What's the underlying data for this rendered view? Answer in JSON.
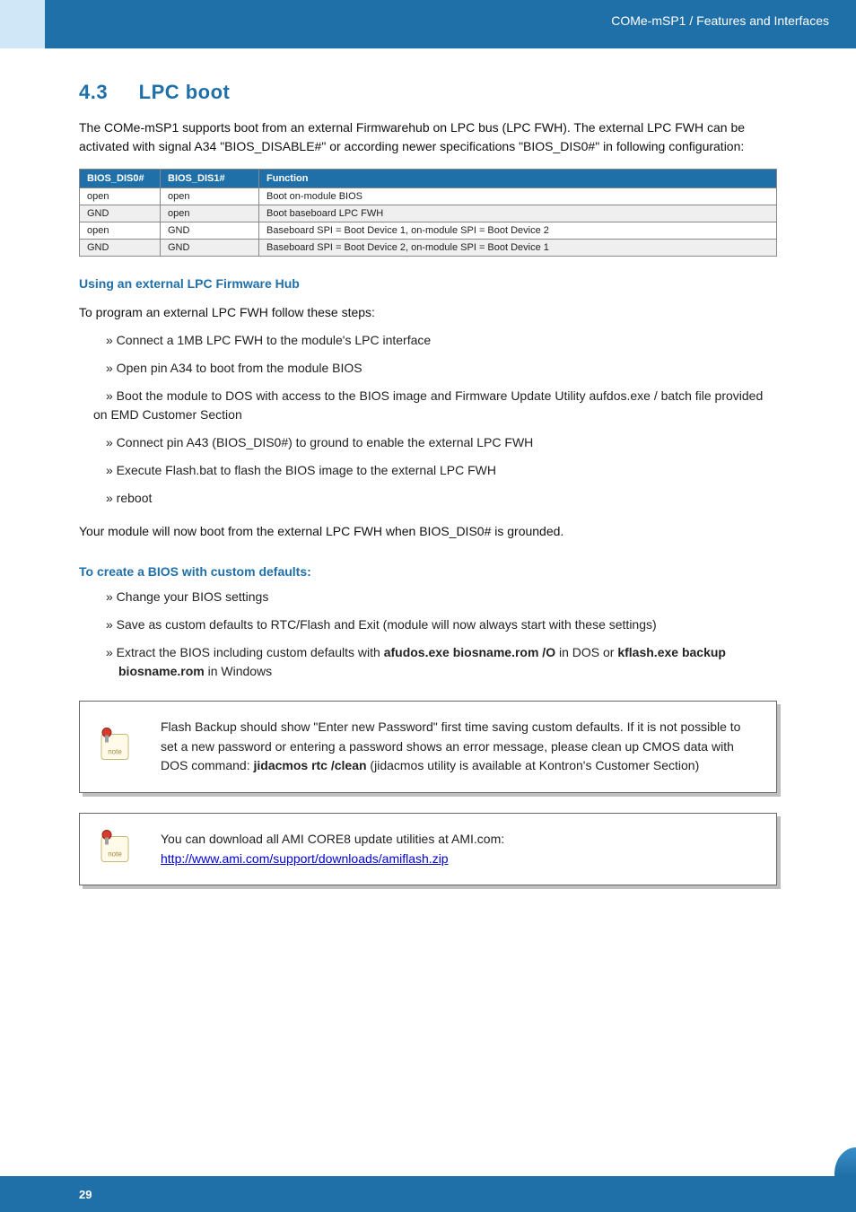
{
  "header": {
    "breadcrumb": "COMe-mSP1 / Features and Interfaces"
  },
  "section": {
    "number": "4.3",
    "title": "LPC boot"
  },
  "intro": "The COMe-mSP1 supports boot from an external Firmwarehub on LPC bus (LPC FWH). The external LPC FWH can be activated with signal A34 \"BIOS_DISABLE#\" or according newer specifications \"BIOS_DIS0#\" in following configuration:",
  "table": {
    "headers": [
      "BIOS_DIS0#",
      "BIOS_DIS1#",
      "Function"
    ],
    "rows": [
      [
        "open",
        "open",
        "Boot on-module BIOS"
      ],
      [
        "GND",
        "open",
        "Boot baseboard LPC FWH"
      ],
      [
        "open",
        "GND",
        "Baseboard SPI = Boot Device 1, on-module SPI = Boot Device 2"
      ],
      [
        "GND",
        "GND",
        "Baseboard SPI = Boot Device 2, on-module SPI = Boot Device 1"
      ]
    ]
  },
  "sec1": {
    "heading": "Using an external LPC Firmware Hub",
    "lead": "To program an external LPC FWH follow these steps:",
    "b1": "» Connect a 1MB LPC FWH to the module's LPC interface",
    "b2": "» Open pin A34 to boot from the module BIOS",
    "b3a": "» Boot the module to DOS with access to the BIOS image and Firmware Update Utility aufdos.exe / batch file provided",
    "b3b": "on EMD Customer Section",
    "b4": "» Connect pin A43 (BIOS_DIS0#) to ground to enable the external LPC FWH",
    "b5": "» Execute Flash.bat to flash the BIOS image to the external LPC FWH",
    "b6": "» reboot",
    "tail": "Your module will now boot from the external LPC FWH when BIOS_DIS0# is grounded."
  },
  "sec2": {
    "heading": "To create a BIOS with custom defaults:",
    "b1": "» Change your BIOS settings",
    "b2": "» Save as custom defaults to RTC/Flash and Exit (module will now always start with these settings)",
    "b3_prefix": "» Extract the BIOS including custom defaults with ",
    "b3_cmd1": "afudos.exe biosname.rom /O",
    "b3_mid": " in DOS or ",
    "b3_cmd2": "kflash.exe backup biosname.rom",
    "b3_suffix": " in Windows"
  },
  "note1": {
    "t1": "Flash Backup should show \"Enter new Password\" first time saving custom defaults. If it is not possible to set a new password or entering a password shows an error message, please clean up CMOS data with DOS command: ",
    "cmd": "jidacmos rtc /clean",
    "t2": " (jidacmos utility is available at Kontron's Customer Section)"
  },
  "note2": {
    "t1": "You can download all AMI CORE8 update utilities at AMI.com:",
    "link": "http://www.ami.com/support/downloads/amiflash.zip"
  },
  "footer": {
    "page": "29"
  }
}
